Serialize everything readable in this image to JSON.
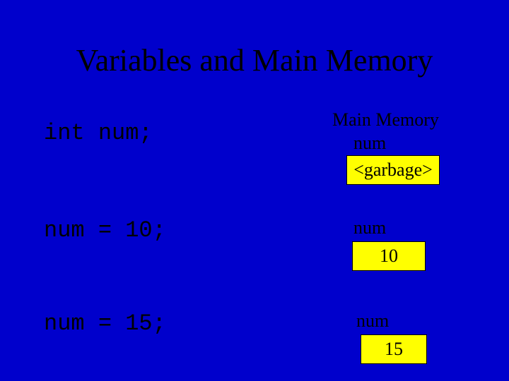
{
  "title": "Variables and Main Memory",
  "memory_header": "Main Memory",
  "code": {
    "line1": "int num;",
    "line2": "num = 10;",
    "line3": "num = 15;"
  },
  "labels": {
    "var1": "num",
    "var2": "num",
    "var3": "num"
  },
  "boxes": {
    "val1": "<garbage>",
    "val2": "10",
    "val3": "15"
  },
  "colors": {
    "background": "#0000cc",
    "box_fill": "#ffff00",
    "text": "#000000"
  }
}
